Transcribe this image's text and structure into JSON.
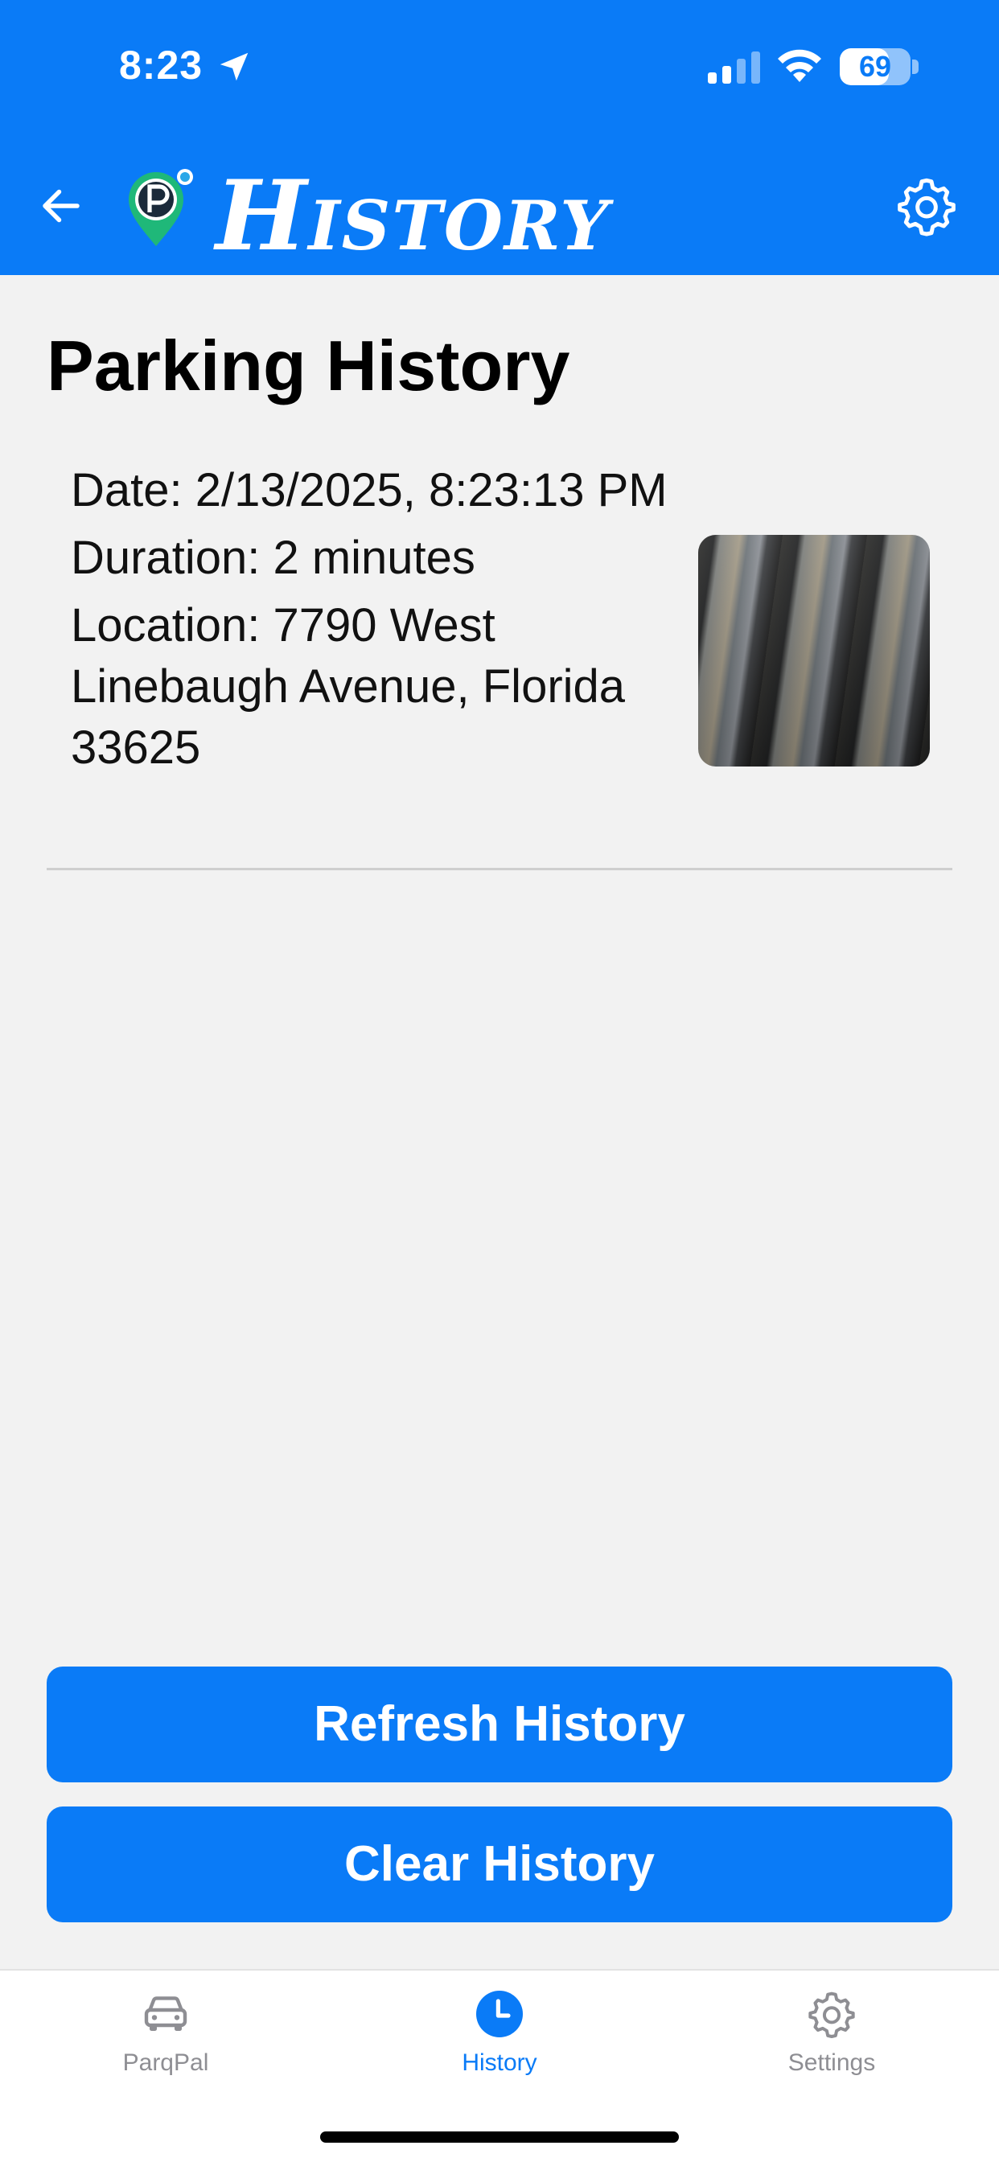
{
  "status_bar": {
    "time": "8:23",
    "battery": "69",
    "battery_level": 0.69
  },
  "header": {
    "title": "History",
    "back_icon": "arrow-left-icon",
    "logo_icon": "parking-pin-logo-icon",
    "settings_icon": "gear-icon"
  },
  "page": {
    "title": "Parking History"
  },
  "history": {
    "items": [
      {
        "date": "Date: 2/13/2025, 8:23:13 PM",
        "duration": "Duration: 2 minutes",
        "location": "Location: 7790 West Linebaugh Avenue, Florida 33625"
      }
    ]
  },
  "actions": {
    "refresh_label": "Refresh History",
    "clear_label": "Clear History"
  },
  "tabbar": {
    "items": [
      {
        "label": "ParqPal",
        "icon": "car-icon",
        "active": false
      },
      {
        "label": "History",
        "icon": "clock-icon",
        "active": true
      },
      {
        "label": "Settings",
        "icon": "gear-icon",
        "active": false
      }
    ]
  },
  "colors": {
    "accent": "#0a7bf7",
    "background": "#f2f2f2",
    "tab_inactive": "#8e8e93"
  }
}
